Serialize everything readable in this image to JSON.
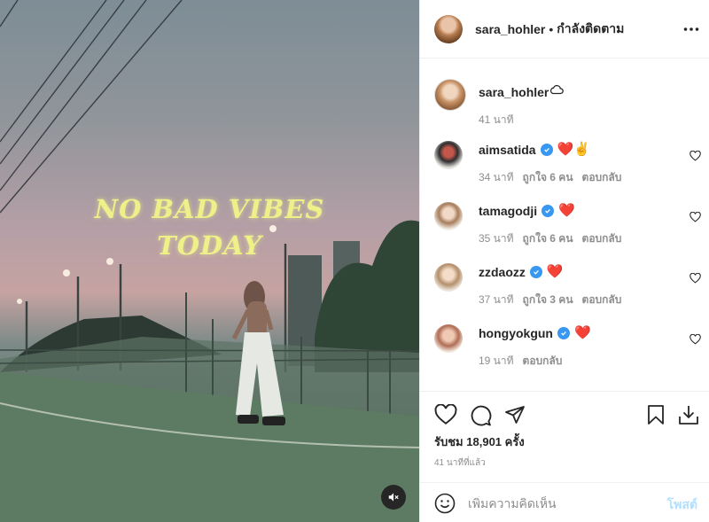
{
  "media": {
    "overlay_line1": "NO BAD VIBES",
    "overlay_line2": "TODAY",
    "mute_icon": "speaker-muted-icon"
  },
  "header": {
    "username": "sara_hohler",
    "separator": "•",
    "follow_status": "กำลังติดตาม",
    "more_icon": "more-dots-icon"
  },
  "caption": {
    "username": "sara_hohler",
    "emoji_icon": "cloud-icon",
    "time": "41 นาที"
  },
  "comments": [
    {
      "username": "aimsatida",
      "verified": true,
      "text_emoji": "❤️✌️",
      "time": "34 นาที",
      "likes": "ถูกใจ 6 คน",
      "reply": "ตอบกลับ"
    },
    {
      "username": "tamagodji",
      "verified": true,
      "text_emoji": "❤️",
      "time": "35 นาที",
      "likes": "ถูกใจ 6 คน",
      "reply": "ตอบกลับ"
    },
    {
      "username": "zzdaozz",
      "verified": true,
      "text_emoji": "❤️",
      "time": "37 นาที",
      "likes": "ถูกใจ 3 คน",
      "reply": "ตอบกลับ"
    },
    {
      "username": "hongyokgun",
      "verified": true,
      "text_emoji": "❤️",
      "time": "19 นาที",
      "likes": "",
      "reply": "ตอบกลับ"
    }
  ],
  "actions": {
    "views_label": "รับชม",
    "views_count": "18,901",
    "views_suffix": "ครั้ง",
    "posted_ago": "41 นาทีที่แล้ว"
  },
  "add_comment": {
    "placeholder": "เพิ่มความคิดเห็น",
    "post_label": "โพสต์"
  },
  "colors": {
    "verified": "#3897f0",
    "heart": "#ed4956",
    "post_button_disabled": "#b2dffc",
    "meta_text": "#8e8e8e",
    "overlay_text": "#eef08a"
  }
}
